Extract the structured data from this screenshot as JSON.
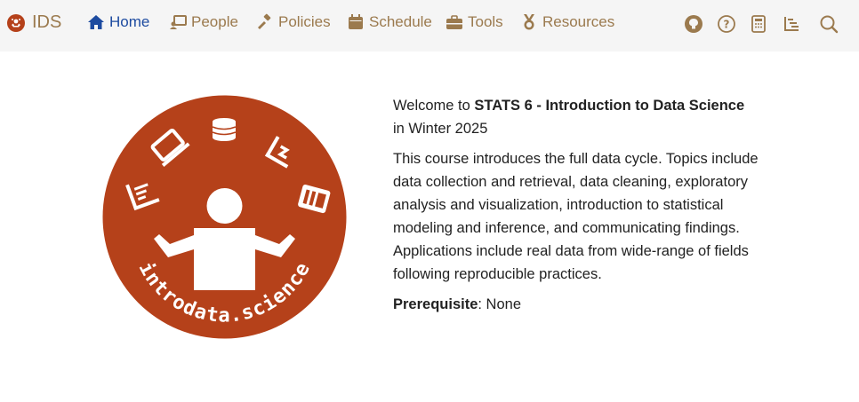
{
  "brand": {
    "text": "IDS"
  },
  "nav": {
    "home": "Home",
    "people": "People",
    "policies": "Policies",
    "schedule": "Schedule",
    "tools": "Tools",
    "resources": "Resources"
  },
  "tools": [
    "github-icon",
    "help-icon",
    "calculator-icon",
    "outline-icon",
    "search-icon"
  ],
  "logo": {
    "text": "introdata.science"
  },
  "colors": {
    "accent_brown": "#9b7a4e",
    "active_blue": "#1d4ba0",
    "logo_orange": "#b5411a",
    "navbar_bg": "#f5f5f5"
  },
  "content": {
    "welcome_prefix": "Welcome to ",
    "course_title": "STATS 6 - Introduction to Data Science",
    "term": "in Winter 2025",
    "description": "This course introduces the full data cycle. Topics include data collection and retrieval, data cleaning, exploratory analysis and visualization, introduction to statistical modeling and inference, and communicating findings. Applications include real data from wide-range of fields following reproducible practices.",
    "prereq_label": "Prerequisite",
    "prereq_sep": ": ",
    "prereq_value": "None"
  }
}
